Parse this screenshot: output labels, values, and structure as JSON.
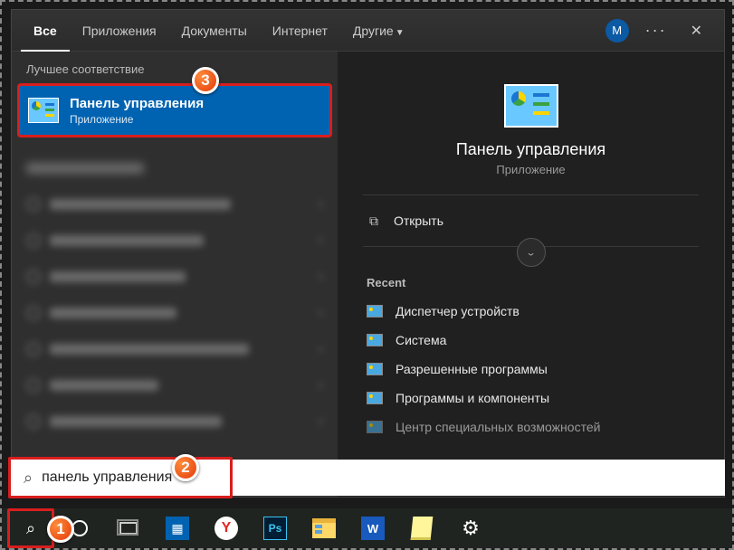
{
  "tabs": {
    "all": "Все",
    "apps": "Приложения",
    "docs": "Документы",
    "web": "Интернет",
    "other": "Другие"
  },
  "avatar_letter": "М",
  "left": {
    "best_label": "Лучшее соответствие",
    "best_title": "Панель управления",
    "best_sub": "Приложение"
  },
  "detail": {
    "title": "Панель управления",
    "sub": "Приложение",
    "open": "Открыть",
    "recent_label": "Recent",
    "recent": [
      "Диспетчер устройств",
      "Система",
      "Разрешенные программы",
      "Программы и компоненты",
      "Центр специальных возможностей"
    ]
  },
  "search": {
    "value": "панель управления"
  },
  "markers": {
    "m1": "1",
    "m2": "2",
    "m3": "3"
  }
}
